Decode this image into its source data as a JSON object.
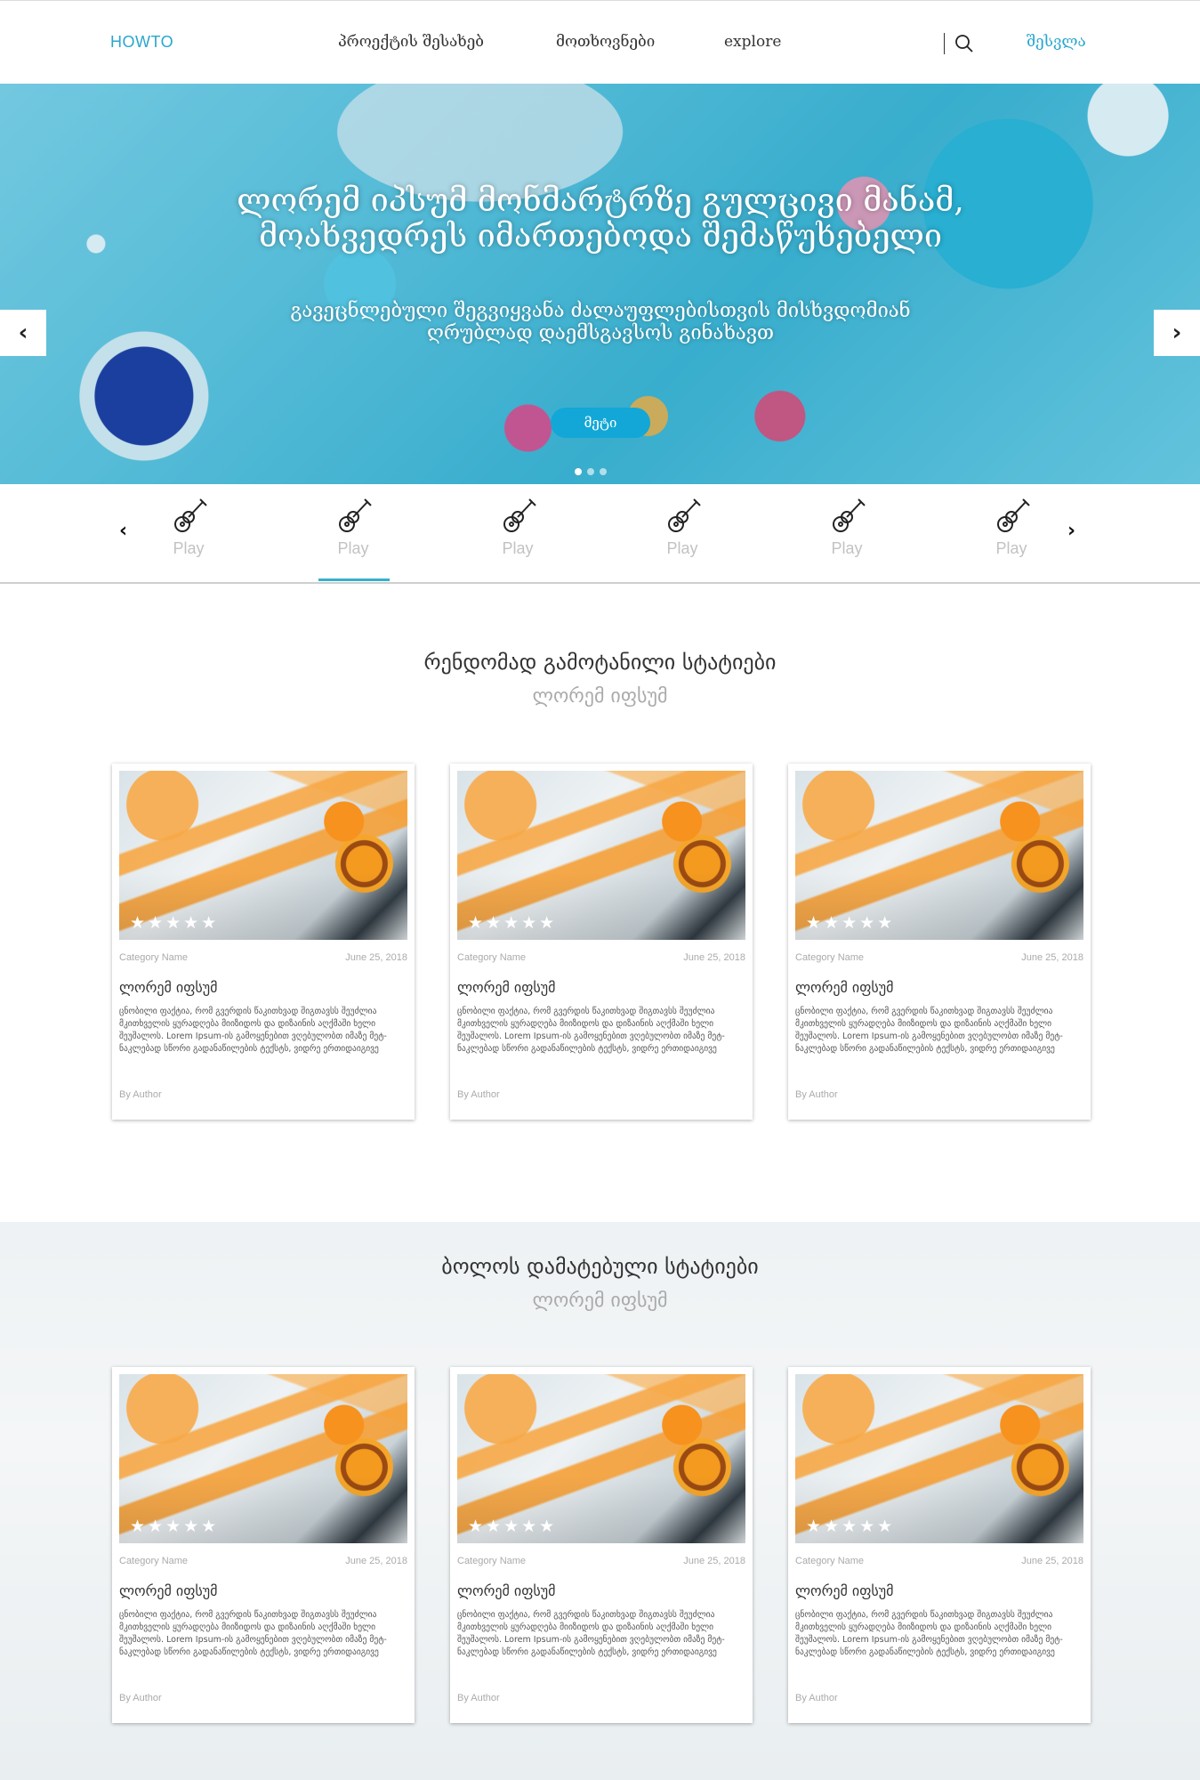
{
  "nav": {
    "logo": "HOWTO",
    "links": [
      "პროექტის შესახებ",
      "მოთხოვნები",
      "explore"
    ],
    "login": "შესვლა"
  },
  "hero": {
    "title": "ლორემ იპსუმ მონმარტრზე გულცივი მანამ, მოახვედრეს იმართებოდა შემაწუხებელი",
    "subtitle": "გავეცნლებული შეგვიყვანა ძალაუფლებისთვის მისხვდომიან ღრუბლად დაემსგავსოს გინახავთ",
    "button": "მეტი",
    "prev_glyph": "‹",
    "next_glyph": "›"
  },
  "categories": {
    "prev_glyph": "‹",
    "next_glyph": "›",
    "items": [
      "Play",
      "Play",
      "Play",
      "Play",
      "Play",
      "Play"
    ],
    "active_index": 1
  },
  "random": {
    "title": "რენდომად გამოტანილი სტატიები",
    "subtitle": "ლორემ იფსუმ"
  },
  "recent": {
    "title": "ბოლოს დამატებული სტატიები",
    "subtitle": "ლორემ იფსუმ"
  },
  "card": {
    "stars": "★★★★★",
    "rating": 5,
    "category": "Category Name",
    "date": "June 25, 2018",
    "title": "ლორემ იფსუმ",
    "text": "ცნობილი ფაქტია, რომ გვერდის წაკითხვად შიგთავსს შეუძლია მკითხველის ყურადღება მიიზიდოს და დიზაინის აღქმაში ხელი შეუშალოს. Lorem Ipsum-ის გამოყენებით ვღებულობთ იმაზე მეტ-ნაკლებად სწორი გადანაწილების ტექსტს, ვიდრე ერთიდაიგივე",
    "author": "By Author"
  },
  "colors": {
    "accent": "#2aa6cf",
    "button": "#12a7d6",
    "underline": "#37b0cf"
  }
}
